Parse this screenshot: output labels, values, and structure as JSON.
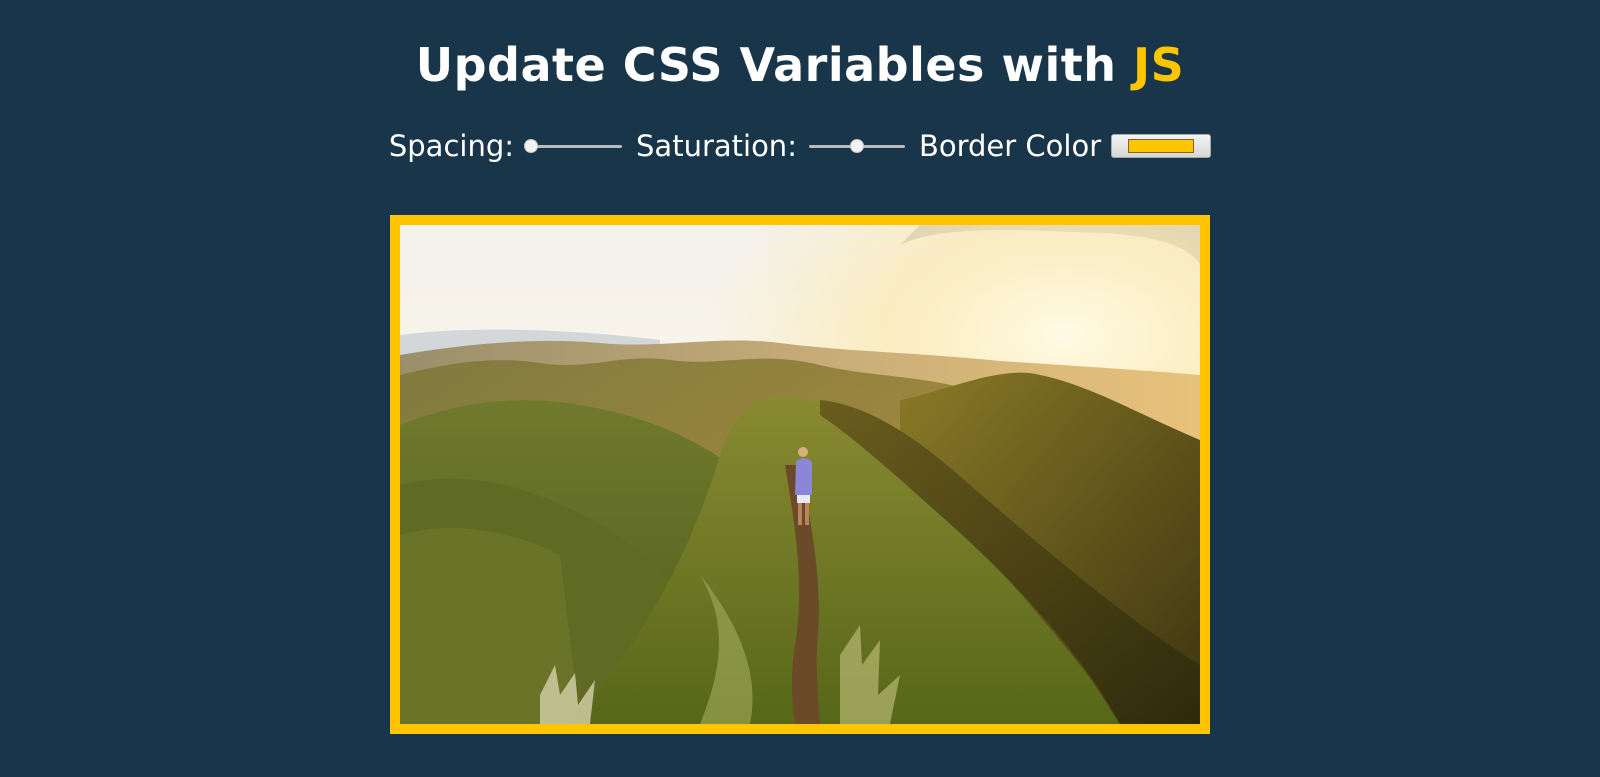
{
  "page": {
    "title_main": "Update CSS Variables with ",
    "title_highlight": "JS",
    "accent_color": "#ffc600",
    "background_color": "#193549"
  },
  "controls": {
    "spacing": {
      "label": "Spacing:",
      "value": 0
    },
    "saturation": {
      "label": "Saturation:",
      "value": 0.5
    },
    "border_color": {
      "label": "Border Color",
      "value": "#ffc600"
    }
  },
  "photo": {
    "description_icon": "mountain-ridge-hiker-photo"
  }
}
